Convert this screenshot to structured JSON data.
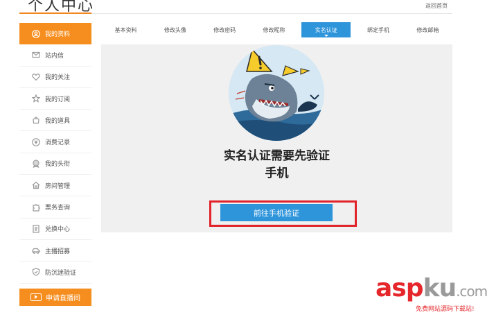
{
  "header": {
    "title": "个人中心",
    "back_link": "返回首页"
  },
  "sidebar": {
    "items": [
      {
        "label": "我的资料",
        "icon": "user-icon",
        "active": true
      },
      {
        "label": "站内信",
        "icon": "mail-icon"
      },
      {
        "label": "我的关注",
        "icon": "heart-icon"
      },
      {
        "label": "我的订阅",
        "icon": "star-icon"
      },
      {
        "label": "我的道具",
        "icon": "bag-icon"
      },
      {
        "label": "消费记录",
        "icon": "yen-icon"
      },
      {
        "label": "我的头衔",
        "icon": "badge-icon"
      },
      {
        "label": "房间管理",
        "icon": "home-icon"
      },
      {
        "label": "票务查询",
        "icon": "puzzle-icon"
      },
      {
        "label": "兑换中心",
        "icon": "doc-icon"
      },
      {
        "label": "主播招募",
        "icon": "car-icon"
      },
      {
        "label": "防沉迷验证",
        "icon": "shield-icon"
      }
    ],
    "apply_button": "申请直播间"
  },
  "tabs": [
    {
      "label": "基本资料"
    },
    {
      "label": "修改头像"
    },
    {
      "label": "修改密码"
    },
    {
      "label": "修改昵称"
    },
    {
      "label": "实名认证",
      "active": true
    },
    {
      "label": "绑定手机"
    },
    {
      "label": "修改邮箱"
    }
  ],
  "main": {
    "message_line1": "实名认证需要先验证",
    "message_line2": "手机",
    "verify_button": "前往手机验证"
  },
  "watermark": {
    "brand_red": "asp",
    "brand_grey": "ku",
    "suffix": ".com",
    "sub": "免费网站源码下载站!"
  },
  "colors": {
    "accent_orange": "#f68e1f",
    "accent_blue": "#2f95db",
    "highlight_red": "#e1232a"
  }
}
